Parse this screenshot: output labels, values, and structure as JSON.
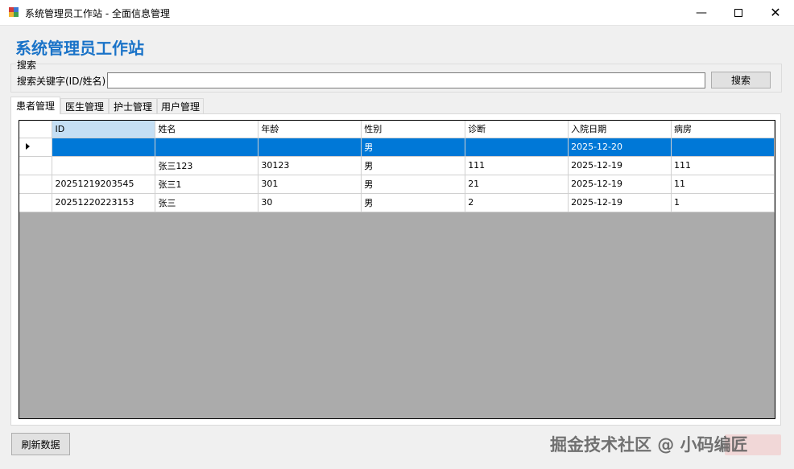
{
  "window": {
    "title": "系统管理员工作站 - 全面信息管理",
    "minimize": "—",
    "close": "✕"
  },
  "heading": "系统管理员工作站",
  "search": {
    "group_title": "搜索",
    "label": "搜索关键字(ID/姓名)",
    "value": "",
    "button": "搜索"
  },
  "tabs": [
    "患者管理",
    "医生管理",
    "护士管理",
    "用户管理"
  ],
  "table": {
    "columns": [
      "ID",
      "姓名",
      "年龄",
      "性别",
      "诊断",
      "入院日期",
      "病房"
    ],
    "rows": [
      [
        "",
        "",
        "",
        "男",
        "",
        "2025-12-20",
        ""
      ],
      [
        "",
        "张三123",
        "30123",
        "男",
        "111",
        "2025-12-19",
        "111"
      ],
      [
        "20251219203545",
        "张三1",
        "301",
        "男",
        "21",
        "2025-12-19",
        "11"
      ],
      [
        "20251220223153",
        "张三",
        "30",
        "男",
        "2",
        "2025-12-19",
        "1"
      ]
    ],
    "selected_row": 0
  },
  "footer": {
    "refresh_button": "刷新数据",
    "watermark": "掘金技术社区 @ 小码编匠"
  },
  "colors": {
    "heading": "#1a73c8",
    "selection": "#0078d7",
    "grid_background": "#ababab"
  }
}
